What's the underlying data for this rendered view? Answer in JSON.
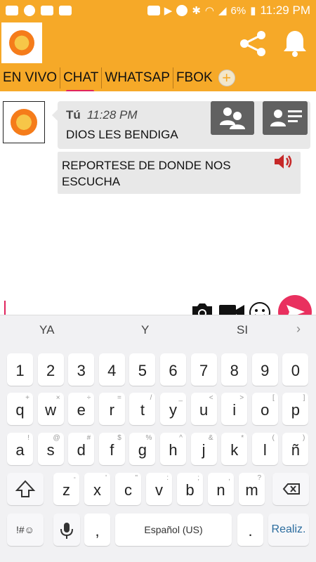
{
  "status_bar": {
    "battery": "6%",
    "time": "11:29 PM"
  },
  "app": {
    "logo_alt": "Radio Naranja"
  },
  "tabs": [
    {
      "label": "EN VIVO"
    },
    {
      "label": "CHAT"
    },
    {
      "label": "WHATSAP"
    },
    {
      "label": "FBOK"
    }
  ],
  "add_tab_label": "+",
  "chat": {
    "messages": [
      {
        "sender": "Tú",
        "time": "11:28 PM",
        "text": "DIOS LES BENDIGA"
      },
      {
        "text": "REPORTESE DE DONDE NOS ESCUCHA"
      }
    ]
  },
  "composer": {
    "value": "",
    "placeholder": ""
  },
  "keyboard": {
    "suggestions": [
      "YA",
      "Y",
      "SI"
    ],
    "more_arrow": "›",
    "number_row": [
      "1",
      "2",
      "3",
      "4",
      "5",
      "6",
      "7",
      "8",
      "9",
      "0"
    ],
    "row1": [
      {
        "k": "q",
        "s": "+"
      },
      {
        "k": "w",
        "s": "×"
      },
      {
        "k": "e",
        "s": "÷"
      },
      {
        "k": "r",
        "s": "="
      },
      {
        "k": "t",
        "s": "/"
      },
      {
        "k": "y",
        "s": "_"
      },
      {
        "k": "u",
        "s": "<"
      },
      {
        "k": "i",
        "s": ">"
      },
      {
        "k": "o",
        "s": "["
      },
      {
        "k": "p",
        "s": "]"
      }
    ],
    "row2": [
      {
        "k": "a",
        "s": "!"
      },
      {
        "k": "s",
        "s": "@"
      },
      {
        "k": "d",
        "s": "#"
      },
      {
        "k": "f",
        "s": "$"
      },
      {
        "k": "g",
        "s": "%"
      },
      {
        "k": "h",
        "s": "^"
      },
      {
        "k": "j",
        "s": "&"
      },
      {
        "k": "k",
        "s": "*"
      },
      {
        "k": "l",
        "s": "("
      },
      {
        "k": "ñ",
        "s": ")"
      }
    ],
    "row3": [
      {
        "k": "z",
        "s": "-"
      },
      {
        "k": "x",
        "s": "'"
      },
      {
        "k": "c",
        "s": "\""
      },
      {
        "k": "v",
        "s": ":"
      },
      {
        "k": "b",
        "s": ";"
      },
      {
        "k": "n",
        "s": ","
      },
      {
        "k": "m",
        "s": "?"
      }
    ],
    "symbols_label": "!#☺",
    "comma": ",",
    "space_label": "Español (US)",
    "period": ".",
    "done_label": "Realiz."
  },
  "colors": {
    "app_bar": "#f6a928",
    "accent": "#e0245e",
    "send": "#e9305f",
    "icon_gray": "#616161"
  }
}
